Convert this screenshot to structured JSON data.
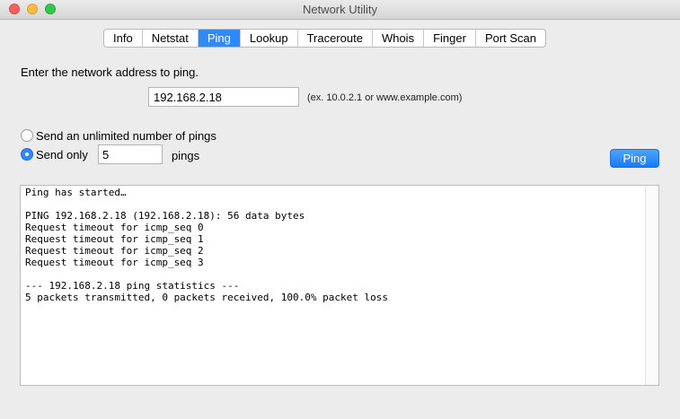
{
  "window": {
    "title": "Network Utility"
  },
  "tabs": [
    {
      "label": "Info",
      "active": false
    },
    {
      "label": "Netstat",
      "active": false
    },
    {
      "label": "Ping",
      "active": true
    },
    {
      "label": "Lookup",
      "active": false
    },
    {
      "label": "Traceroute",
      "active": false
    },
    {
      "label": "Whois",
      "active": false
    },
    {
      "label": "Finger",
      "active": false
    },
    {
      "label": "Port Scan",
      "active": false
    }
  ],
  "ping": {
    "prompt": "Enter the network address to ping.",
    "address_value": "192.168.2.18",
    "address_hint": "(ex. 10.0.2.1 or www.example.com)",
    "option_unlimited_label": "Send an unlimited number of pings",
    "option_unlimited_selected": false,
    "option_sendonly_label": "Send only",
    "option_sendonly_selected": true,
    "count_value": "5",
    "count_suffix": "pings",
    "button_label": "Ping"
  },
  "output": {
    "text": "Ping has started…\n\nPING 192.168.2.18 (192.168.2.18): 56 data bytes\nRequest timeout for icmp_seq 0\nRequest timeout for icmp_seq 1\nRequest timeout for icmp_seq 2\nRequest timeout for icmp_seq 3\n\n--- 192.168.2.18 ping statistics ---\n5 packets transmitted, 0 packets received, 100.0% packet loss"
  },
  "colors": {
    "accent": "#2f8af7",
    "close": "#fc605c",
    "minimize": "#fdbc40",
    "maximize": "#34c84a"
  }
}
